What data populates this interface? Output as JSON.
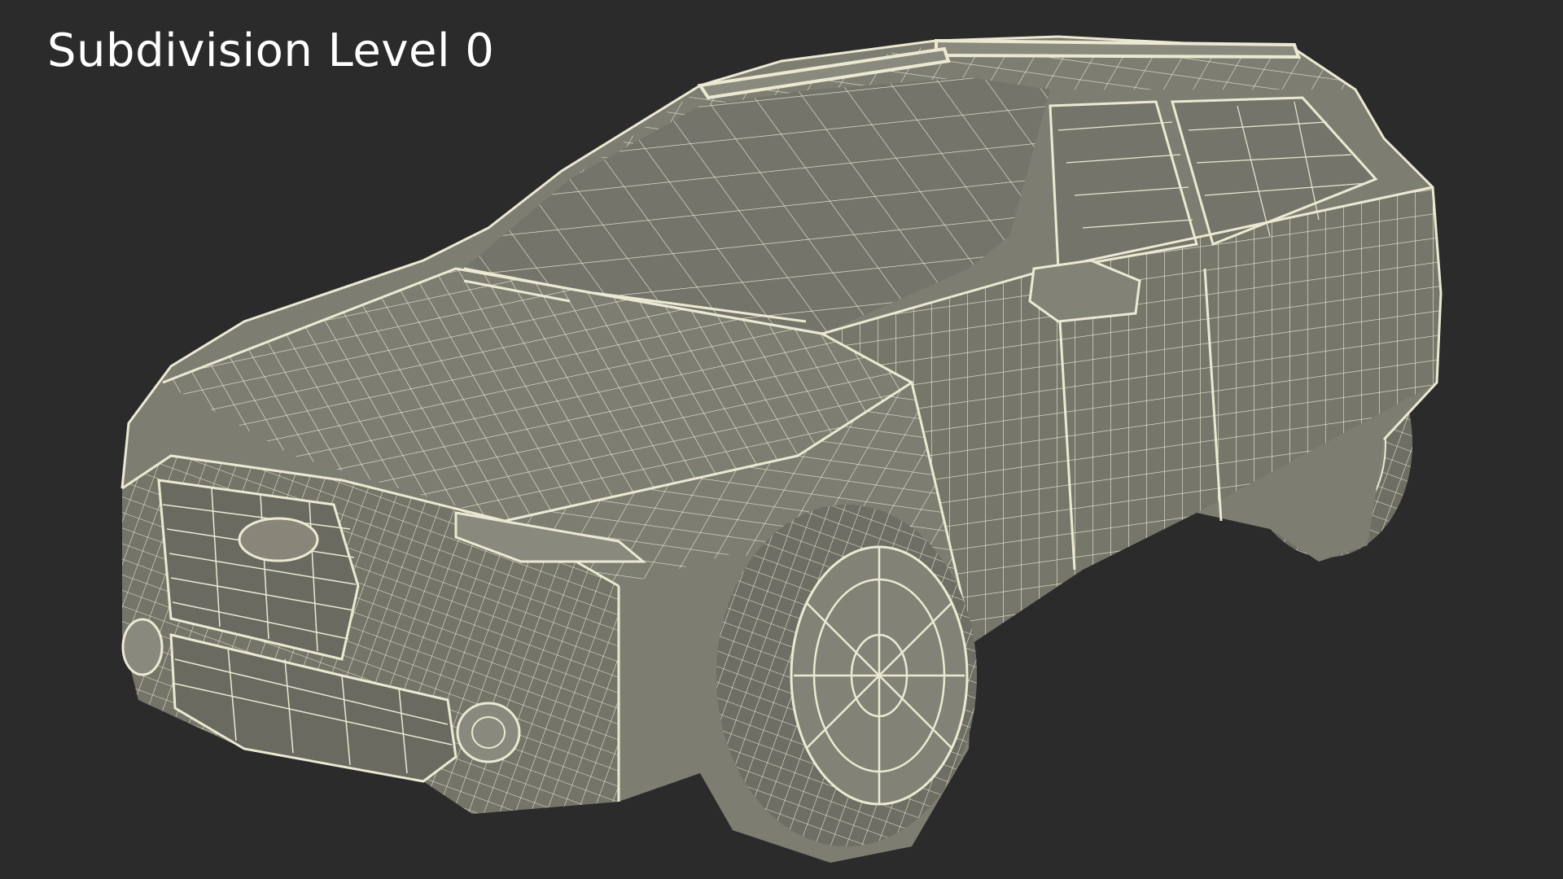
{
  "caption": "Subdivision Level 0",
  "colors": {
    "background": "#2b2b2b",
    "body_fill": "#7e7d72",
    "body_shade": "#6b6a60",
    "glass_fill": "#77766b",
    "wire": "#ece9d3",
    "caption_text": "#ffffff"
  },
  "subject": {
    "icon": "wireframe-car-icon"
  }
}
